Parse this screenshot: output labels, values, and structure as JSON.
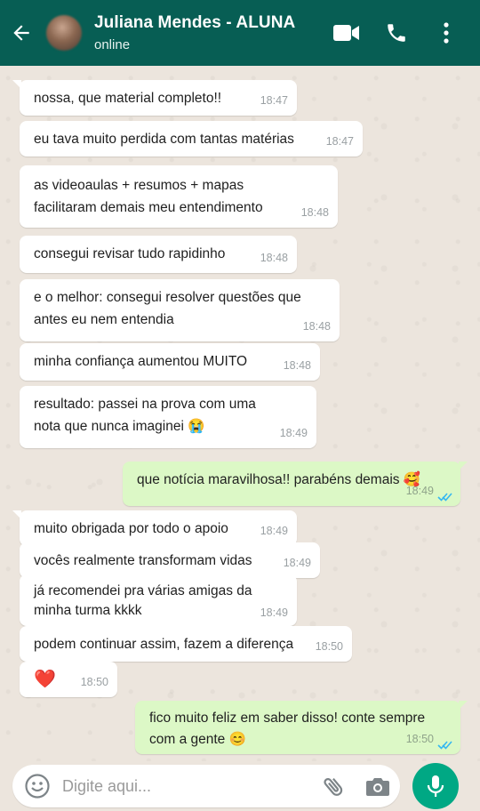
{
  "header": {
    "contact_name": "Juliana Mendes - ALUNA",
    "status": "online",
    "icons": [
      "back-arrow-icon",
      "video-call-icon",
      "phone-icon",
      "more-vert-icon"
    ]
  },
  "messages": [
    {
      "dir": "in",
      "text": "nossa, que material completo!!",
      "time": "18:47"
    },
    {
      "dir": "in",
      "text": "eu tava muito perdida com tantas matérias",
      "time": "18:47"
    },
    {
      "dir": "in",
      "text": "as videoaulas + resumos + mapas facilitaram demais meu entendimento",
      "time": "18:48"
    },
    {
      "dir": "in",
      "text": "consegui revisar tudo rapidinho",
      "time": "18:48"
    },
    {
      "dir": "in",
      "text": "e o melhor: consegui resolver questões que antes eu nem entendia",
      "time": "18:48"
    },
    {
      "dir": "in",
      "text": "minha confiança aumentou MUITO",
      "time": "18:48"
    },
    {
      "dir": "in",
      "text": "resultado: passei na prova com uma nota que nunca imaginei 😭",
      "time": "18:49"
    },
    {
      "dir": "out",
      "text": "que notícia maravilhosa!! parabéns demais 🥰",
      "time": "18:49"
    },
    {
      "dir": "in",
      "text": "muito obrigada por todo o apoio",
      "time": "18:49"
    },
    {
      "dir": "in",
      "text": "vocês realmente transformam vidas",
      "time": "18:49"
    },
    {
      "dir": "in",
      "text": "já recomendei pra várias amigas da minha turma kkkk",
      "time": "18:49"
    },
    {
      "dir": "in",
      "text": "podem continuar assim, fazem a diferença",
      "time": "18:50"
    },
    {
      "dir": "in",
      "text": "❤️",
      "time": "18:50"
    },
    {
      "dir": "out",
      "text": "fico muito feliz em saber disso! conte sempre com a gente 😊",
      "time": "18:50"
    }
  ],
  "composer": {
    "placeholder": "Digite aqui...",
    "icons": [
      "emoji-icon",
      "attach-icon",
      "camera-icon",
      "mic-icon"
    ]
  },
  "colors": {
    "header": "#075e54",
    "incoming_bubble": "#ffffff",
    "outgoing_bubble": "#dcf8c6",
    "read_ticks": "#34b7f1",
    "mic_button": "#00a884"
  }
}
